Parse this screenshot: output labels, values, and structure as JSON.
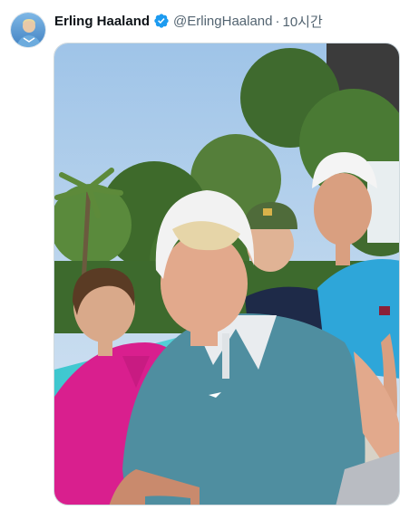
{
  "tweet": {
    "author_name": "Erling Haaland",
    "handle": "@ErlingHaaland",
    "separator": "·",
    "time": "10시간",
    "verified": true,
    "accent_color": "#1d9bf0"
  },
  "media": {
    "icon": "photo"
  }
}
